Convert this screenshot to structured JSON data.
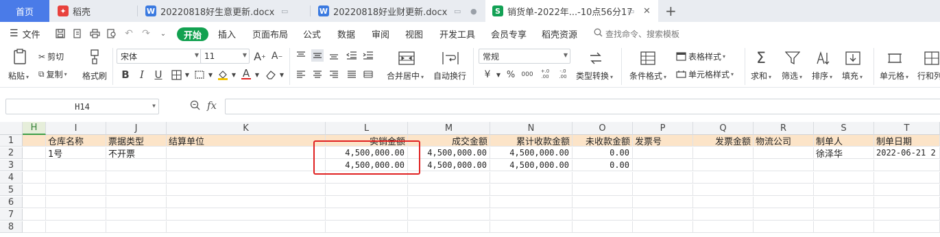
{
  "tabs": {
    "home": "首页",
    "docer": "稻壳",
    "doc1": "20220818好生意更新.docx",
    "doc2": "20220818好业财更新.docx",
    "sheet": "销货单-2022年...-10点56分17",
    "new_tab": "+"
  },
  "menu": {
    "file": "文件",
    "start": "开始",
    "items": [
      "插入",
      "页面布局",
      "公式",
      "数据",
      "审阅",
      "视图",
      "开发工具",
      "会员专享",
      "稻壳资源"
    ],
    "search": "查找命令、搜索模板"
  },
  "ribbon": {
    "paste": "粘贴",
    "cut": "剪切",
    "copy": "复制",
    "format_painter": "格式刷",
    "font_name": "宋体",
    "font_size": "11",
    "merge_center": "合并居中",
    "wrap_text": "自动换行",
    "number_format": "常规",
    "type_convert": "类型转换",
    "conditional_format": "条件格式",
    "table_style": "表格样式",
    "cell_style": "单元格样式",
    "sum": "求和",
    "filter": "筛选",
    "sort": "排序",
    "fill": "填充",
    "cells": "单元格",
    "rows_cols": "行和列",
    "bold": "B",
    "italic": "I",
    "underline": "U",
    "font_color_letter": "A",
    "grow_font": "A",
    "shrink_font": "A",
    "currency": "¥",
    "percent": "%",
    "thousands": "000",
    "inc_decimal": "+.0 .00",
    "dec_decimal": "-.0 .00"
  },
  "formula_bar": {
    "cell_ref": "H14",
    "fx": "fx",
    "content": ""
  },
  "grid": {
    "columns": [
      "H",
      "I",
      "J",
      "K",
      "L",
      "M",
      "N",
      "O",
      "P",
      "Q",
      "R",
      "S",
      "T"
    ],
    "row_numbers": [
      "1",
      "2",
      "3",
      "4",
      "5",
      "6",
      "7",
      "8"
    ],
    "header_row": [
      "",
      "仓库名称",
      "票据类型",
      "结算单位",
      "实销金额",
      "成交金额",
      "累计收款金额",
      "未收款金额",
      "发票号",
      "发票金额",
      "物流公司",
      "制单人",
      "制单日期"
    ],
    "row2": [
      "",
      "1号",
      "不开票",
      "",
      "4,500,000.00",
      "4,500,000.00",
      "4,500,000.00",
      "0.00",
      "",
      "",
      "",
      "徐泽华",
      "2022-06-21 2"
    ],
    "row3": [
      "",
      "",
      "",
      "",
      "4,500,000.00",
      "4,500,000.00",
      "4,500,000.00",
      "0.00",
      "",
      "",
      "",
      "",
      ""
    ]
  },
  "colors": {
    "accent_green": "#12a150",
    "header_fill": "#fce4c8",
    "highlight_box": "#e02020",
    "home_tab": "#4a7be8"
  }
}
